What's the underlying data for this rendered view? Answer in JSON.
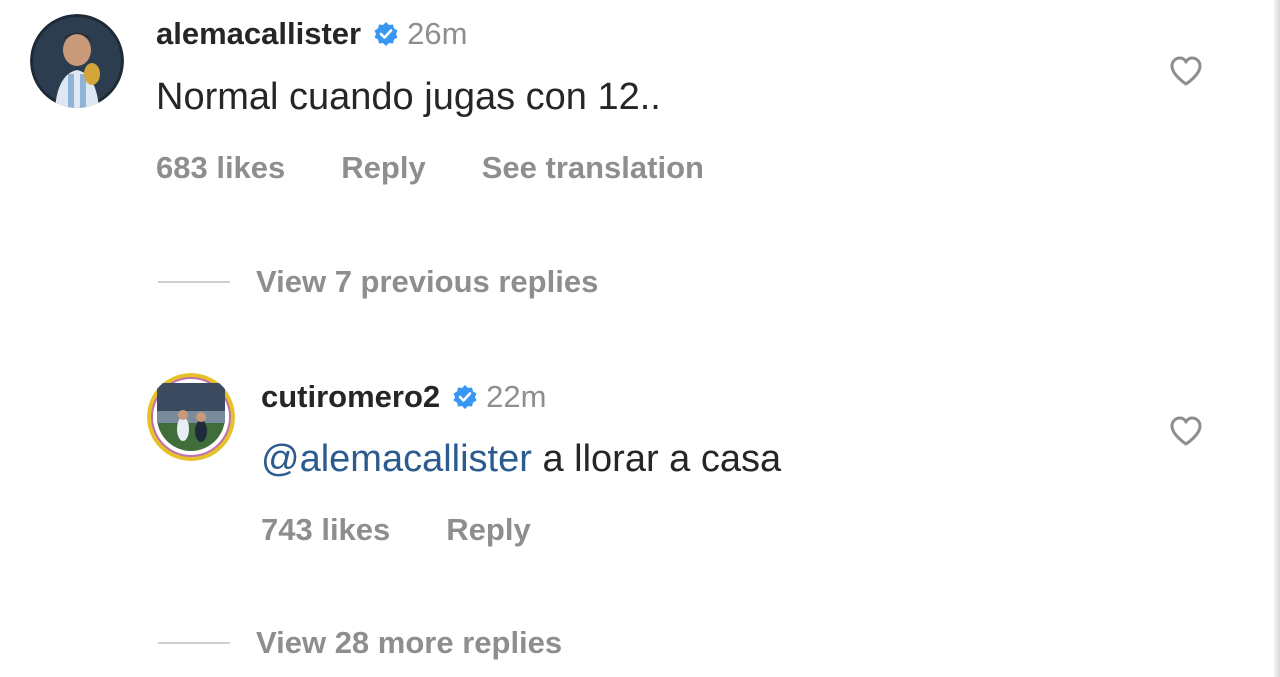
{
  "comments": [
    {
      "username": "alemacallister",
      "time": "26m",
      "text": "Normal cuando jugas con 12..",
      "likes": "683 likes",
      "reply_label": "Reply",
      "translate_label": "See translation",
      "verified": true,
      "avatar_icon": "profile-photo"
    },
    {
      "username": "cutiromero2",
      "time": "22m",
      "mention": "@alemacallister",
      "text": "a llorar a casa",
      "likes": "743 likes",
      "reply_label": "Reply",
      "verified": true,
      "avatar_icon": "profile-photo-with-story-ring"
    }
  ],
  "thread": {
    "previous_replies": "View 7 previous replies",
    "more_replies": "View 28 more replies"
  },
  "colors": {
    "username": "#262626",
    "secondary": "#8e8e8e",
    "verified": "#3897f0",
    "mention": "#2b5b8f",
    "story_ring": "#e6c229"
  },
  "icons": {
    "like": "heart-outline-icon",
    "verified": "verified-badge-icon"
  }
}
